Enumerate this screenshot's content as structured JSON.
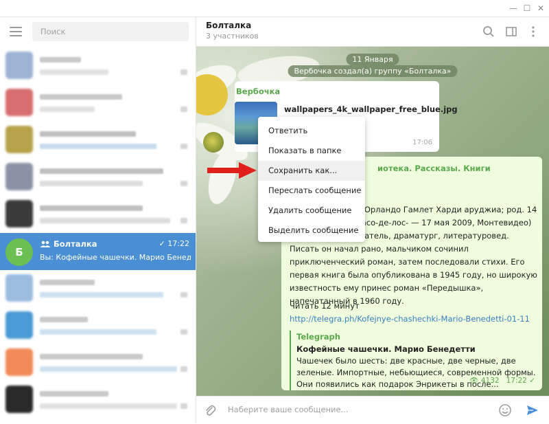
{
  "window": {
    "minimize": "—",
    "maximize": "☐",
    "close": "✕"
  },
  "sidebar": {
    "search_placeholder": "Поиск",
    "blurred_chats": [
      {
        "avatar": "#9cb3d3",
        "line1": "#c9c9c9",
        "line2": "#e2e2e2",
        "w1": 60,
        "w2": 100
      },
      {
        "avatar": "#d86e70",
        "line1": "#c9c9c9",
        "line2": "#e2e2e2",
        "w1": 120,
        "w2": 80
      },
      {
        "avatar": "#b8a34a",
        "line1": "#c0c0c0",
        "line2": "#c8dcee",
        "w1": 140,
        "w2": 170
      },
      {
        "avatar": "#8a93a5",
        "line1": "#c0c0c0",
        "line2": "#dedede",
        "w1": 180,
        "w2": 150
      },
      {
        "avatar": "#3a3a3a",
        "line1": "#c0c0c0",
        "line2": "#dedede",
        "w1": 150,
        "w2": 190
      }
    ],
    "active_chat": {
      "avatar_letter": "Б",
      "name": "Болталка",
      "time": "17:22",
      "preview": "Вы: Кофейные чашечки. Марио Бенедетти"
    },
    "blurred_chats_after": [
      {
        "avatar": "#9cbde0",
        "line1": "#c9c9c9",
        "line2": "#cfe1f0",
        "w1": 80,
        "w2": 180
      },
      {
        "avatar": "#4a9ad6",
        "line1": "#c9c9c9",
        "line2": "#cfe1f0",
        "w1": 70,
        "w2": 170
      },
      {
        "avatar": "#f28a5a",
        "line1": "#c9c9c9",
        "line2": "#cfe1f0",
        "w1": 150,
        "w2": 200
      },
      {
        "avatar": "#2a2a2a",
        "line1": "#c9c9c9",
        "line2": "#e2e2e2",
        "w1": 100,
        "w2": 200
      }
    ]
  },
  "header": {
    "title": "Болталка",
    "subtitle": "3 участников"
  },
  "chat": {
    "date_pill": "11 Января",
    "service_msg": "Вербочка создал(а) группу «Болталка»",
    "msg1": {
      "sender": "Вербочка",
      "file": "wallpapers_4k_wallpaper_free_blue.jpg",
      "time": "17:06"
    },
    "msg2": {
      "channel": "иотека. Рассказы. Книги",
      "body": "олное имя Марио Орландо Гамлет Харди аруджиа; род. 14 сентября 1920, Пасо-де-лос- — 17 мая 2009, Монтевидео) — уругвайский исатель, драматург, литературовед. Писать он начал рано, мальчиком сочинил приключенческий роман, затем последовали стихи. Его первая книга была опубликована в 1945 году, но широкую известность ему принес роман «Передышка», напечатанный в 1960 году.",
      "read_time": "Читать 12 минут",
      "link": "http://telegra.ph/Kofejnye-chashechki-Mario-Benedetti-01-11",
      "preview_source": "Telegraph",
      "preview_title": "Кофейные чашечки. Марио Бенедетти",
      "preview_text": "Чашечек было шесть: две красные, две черные, две зеленые. Импортные, небьющиеся, современной формы. Они появились как подарок Энрикеты в после...",
      "views": "4132",
      "time": "17:22"
    }
  },
  "context_menu": {
    "items": [
      "Ответить",
      "Показать в папке",
      "Сохранить как...",
      "Переслать сообщение",
      "Удалить сообщение",
      "Выделить сообщение"
    ],
    "highlighted_index": 2
  },
  "composer": {
    "placeholder": "Наберите ваше сообщение..."
  },
  "colors": {
    "accent_blue": "#4a8fd4",
    "green": "#5ba84c",
    "arrow_red": "#e0201a"
  }
}
